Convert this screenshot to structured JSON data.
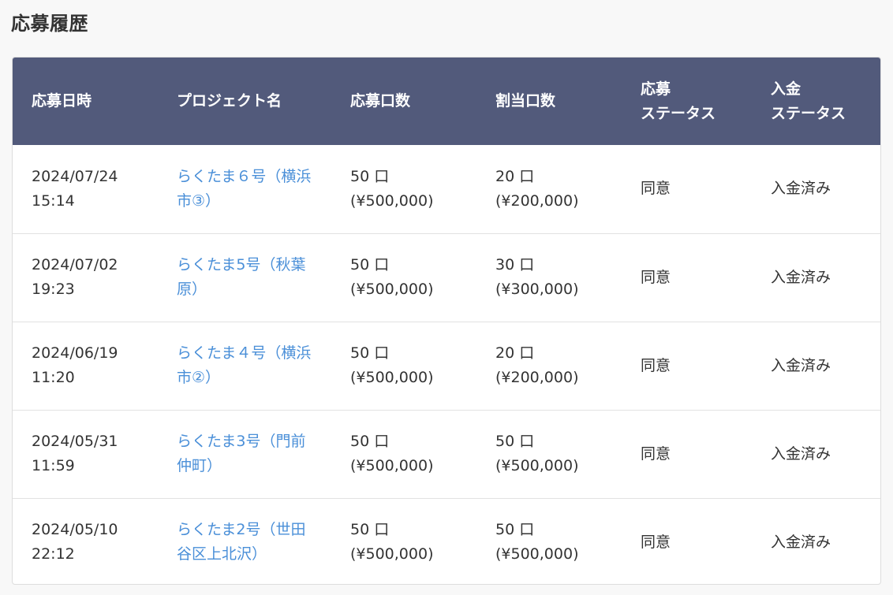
{
  "page": {
    "title": "応募履歴"
  },
  "table": {
    "headers": {
      "date": "応募日時",
      "project": "プロジェクト名",
      "units": "応募口数",
      "allocated": "割当口数",
      "status_line1": "応募",
      "status_line2": "ステータス",
      "payment_line1": "入金",
      "payment_line2": "ステータス"
    },
    "rows": [
      {
        "date": "2024/07/24",
        "time": "15:14",
        "project": "らくたま６号（横浜市③）",
        "units": "50 口",
        "units_amount": "(¥500,000)",
        "allocated": "20 口",
        "allocated_amount": "(¥200,000)",
        "status": "同意",
        "payment": "入金済み"
      },
      {
        "date": "2024/07/02",
        "time": "19:23",
        "project": "らくたま5号（秋葉原）",
        "units": "50 口",
        "units_amount": "(¥500,000)",
        "allocated": "30 口",
        "allocated_amount": "(¥300,000)",
        "status": "同意",
        "payment": "入金済み"
      },
      {
        "date": "2024/06/19",
        "time": "11:20",
        "project": "らくたま４号（横浜市②）",
        "units": "50 口",
        "units_amount": "(¥500,000)",
        "allocated": "20 口",
        "allocated_amount": "(¥200,000)",
        "status": "同意",
        "payment": "入金済み"
      },
      {
        "date": "2024/05/31",
        "time": "11:59",
        "project": "らくたま3号（門前仲町）",
        "units": "50 口",
        "units_amount": "(¥500,000)",
        "allocated": "50 口",
        "allocated_amount": "(¥500,000)",
        "status": "同意",
        "payment": "入金済み"
      },
      {
        "date": "2024/05/10",
        "time": "22:12",
        "project": "らくたま2号（世田谷区上北沢）",
        "units": "50 口",
        "units_amount": "(¥500,000)",
        "allocated": "50 口",
        "allocated_amount": "(¥500,000)",
        "status": "同意",
        "payment": "入金済み"
      }
    ]
  },
  "colors": {
    "header_bg": "#525a7b",
    "link": "#4a8fd8",
    "text": "#333333"
  }
}
